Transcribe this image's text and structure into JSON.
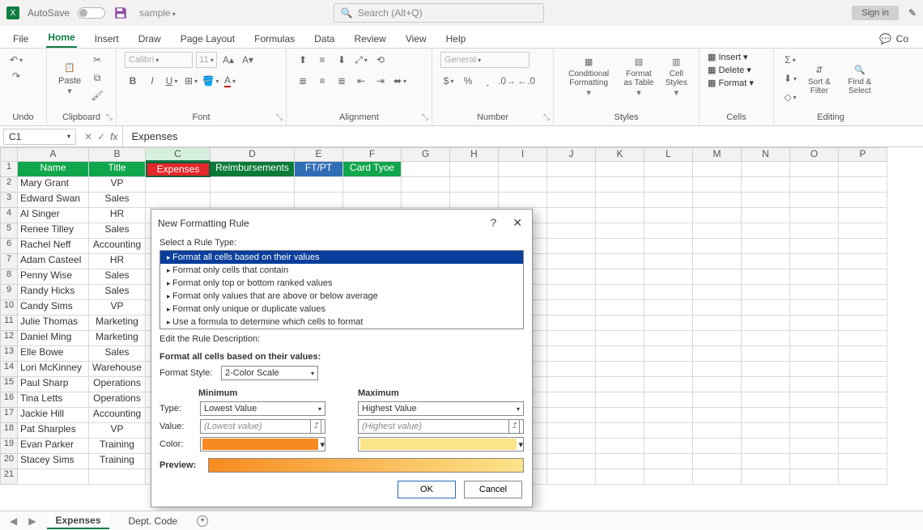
{
  "titlebar": {
    "autosave": "AutoSave",
    "filename": "sample",
    "search_placeholder": "Search (Alt+Q)",
    "signin": "Sign in"
  },
  "menu": {
    "file": "File",
    "home": "Home",
    "insert": "Insert",
    "draw": "Draw",
    "pagelayout": "Page Layout",
    "formulas": "Formulas",
    "data": "Data",
    "review": "Review",
    "view": "View",
    "help": "Help",
    "comments": "Co"
  },
  "ribbon": {
    "undo": "Undo",
    "clipboard": "Clipboard",
    "paste": "Paste",
    "font": "Font",
    "fontname": "Calibri",
    "fontsize": "11",
    "alignment": "Alignment",
    "number": "Number",
    "numfmt": "General",
    "styles": "Styles",
    "cf": "Conditional Formatting",
    "fat": "Format as Table",
    "cs": "Cell Styles",
    "cells": "Cells",
    "insert": "Insert",
    "delete": "Delete",
    "format": "Format",
    "editing": "Editing",
    "sortfilter": "Sort & Filter",
    "findselect": "Find & Select"
  },
  "formula": {
    "namebox": "C1",
    "text": "Expenses"
  },
  "columns": [
    "A",
    "B",
    "C",
    "D",
    "E",
    "F",
    "G",
    "H",
    "I",
    "J",
    "K",
    "L",
    "M",
    "N",
    "O",
    "P"
  ],
  "headers": {
    "A": "Name",
    "B": "Title",
    "C": "Expenses",
    "D": "Reimbursements",
    "E": "FT/PT",
    "F": "Card Tyoe"
  },
  "rows": [
    {
      "n": "2",
      "A": "Mary Grant",
      "B": "VP"
    },
    {
      "n": "3",
      "A": "Edward Swan",
      "B": "Sales"
    },
    {
      "n": "4",
      "A": "Al Singer",
      "B": "HR"
    },
    {
      "n": "5",
      "A": "Renee Tilley",
      "B": "Sales"
    },
    {
      "n": "6",
      "A": "Rachel Neff",
      "B": "Accounting"
    },
    {
      "n": "7",
      "A": "Adam Casteel",
      "B": "HR"
    },
    {
      "n": "8",
      "A": "Penny Wise",
      "B": "Sales"
    },
    {
      "n": "9",
      "A": "Randy Hicks",
      "B": "Sales"
    },
    {
      "n": "10",
      "A": "Candy Sims",
      "B": "VP"
    },
    {
      "n": "11",
      "A": "Julie Thomas",
      "B": "Marketing"
    },
    {
      "n": "12",
      "A": "Daniel Ming",
      "B": "Marketing"
    },
    {
      "n": "13",
      "A": "Elle Bowe",
      "B": "Sales"
    },
    {
      "n": "14",
      "A": "Lori McKinney",
      "B": "Warehouse"
    },
    {
      "n": "15",
      "A": "Paul Sharp",
      "B": "Operations"
    },
    {
      "n": "16",
      "A": "Tina Letts",
      "B": "Operations"
    },
    {
      "n": "17",
      "A": "Jackie Hill",
      "B": "Accounting"
    },
    {
      "n": "18",
      "A": "Pat Sharples",
      "B": "VP"
    },
    {
      "n": "19",
      "A": "Evan Parker",
      "B": "Training"
    },
    {
      "n": "20",
      "A": "Stacey Sims",
      "B": "Training"
    },
    {
      "n": "21",
      "A": "",
      "B": ""
    }
  ],
  "sheets": {
    "active": "Expenses",
    "other": "Dept. Code"
  },
  "dialog": {
    "title": "New Formatting Rule",
    "select_label": "Select a Rule Type:",
    "rules": [
      "Format all cells based on their values",
      "Format only cells that contain",
      "Format only top or bottom ranked values",
      "Format only values that are above or below average",
      "Format only unique or duplicate values",
      "Use a formula to determine which cells to format"
    ],
    "edit_label": "Edit the Rule Description:",
    "desc_header": "Format all cells based on their values:",
    "format_style_lbl": "Format Style:",
    "format_style_val": "2-Color Scale",
    "min_lbl": "Minimum",
    "max_lbl": "Maximum",
    "type_lbl": "Type:",
    "type_min": "Lowest Value",
    "type_max": "Highest Value",
    "value_lbl": "Value:",
    "value_min": "(Lowest value)",
    "value_max": "(Highest value)",
    "color_lbl": "Color:",
    "preview_lbl": "Preview:",
    "ok": "OK",
    "cancel": "Cancel"
  }
}
